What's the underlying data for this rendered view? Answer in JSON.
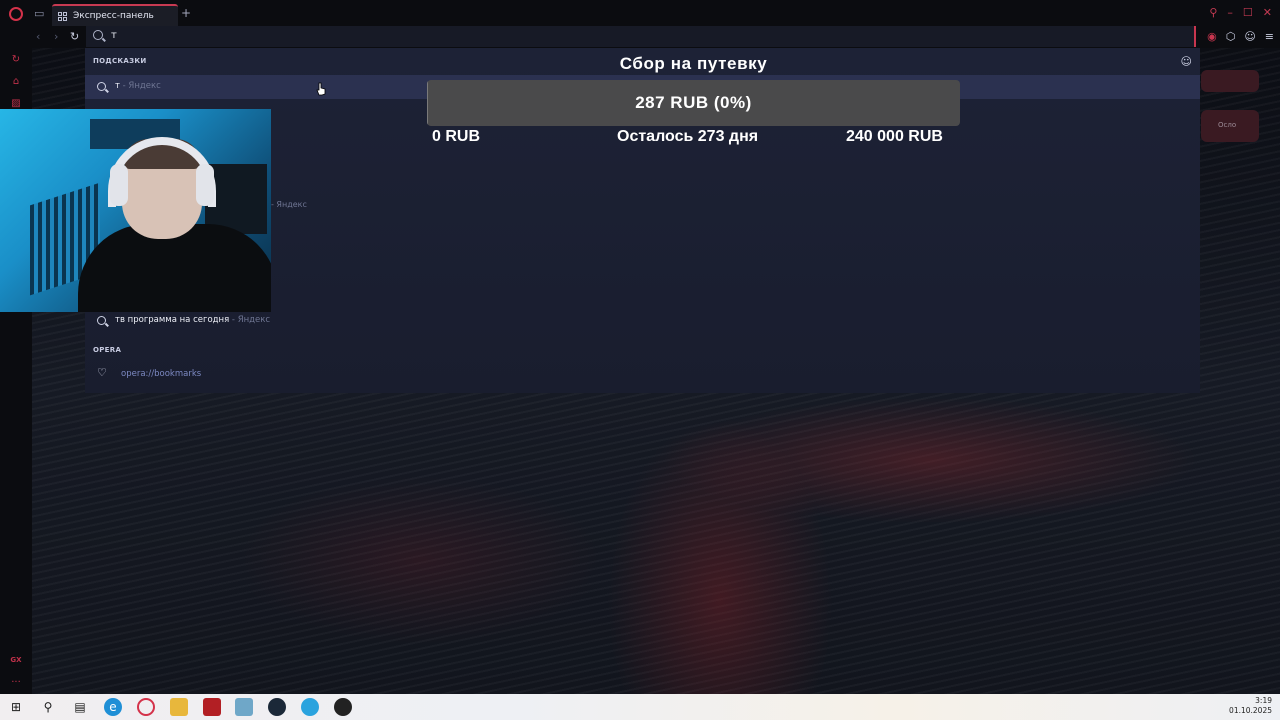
{
  "browser": {
    "tab_label": "Экспресс-панель",
    "new_tab_symbol": "+",
    "omnibox_value": "т",
    "sidebar_bottom_label": "GX",
    "sidebar_more": "...",
    "icons": [
      "opera-logo-icon",
      "tab-strip-icon",
      "speed-dial-icon",
      "search-icon",
      "heart-icon",
      "extensions-icon",
      "profile-icon",
      "menu-icon",
      "vpn-icon"
    ],
    "accent_color": "#c8364f"
  },
  "suggestions": {
    "section_label": "ПОДСКАЗКИ",
    "items": [
      {
        "text": "т",
        "source": " - Яндекс"
      },
      {
        "text": "тв программа на сегодня",
        "source": " - Яндекс"
      }
    ],
    "hidden_item_source": "- Яндекс",
    "opera_section_label": "OPERA",
    "bookmarks_link": "opera://bookmarks"
  },
  "speed_dial": {
    "tile_label": "Осло"
  },
  "donation_goal": {
    "title": "Сбор на путевку",
    "current_label": "287 RUB (0%)",
    "progress_fraction": 0.0012,
    "min_label": "0 RUB",
    "days_left_label": "Осталось 273 дня",
    "max_label": "240 000 RUB"
  },
  "taskbar": {
    "time": "3:19",
    "date": "01.10.2025",
    "apps": [
      "windows-start-icon",
      "search-icon",
      "task-view-icon",
      "edge-icon",
      "opera-gx-icon",
      "file-explorer-icon",
      "dota-icon",
      "notepad-icon",
      "steam-icon",
      "telegram-icon",
      "obs-icon"
    ]
  }
}
